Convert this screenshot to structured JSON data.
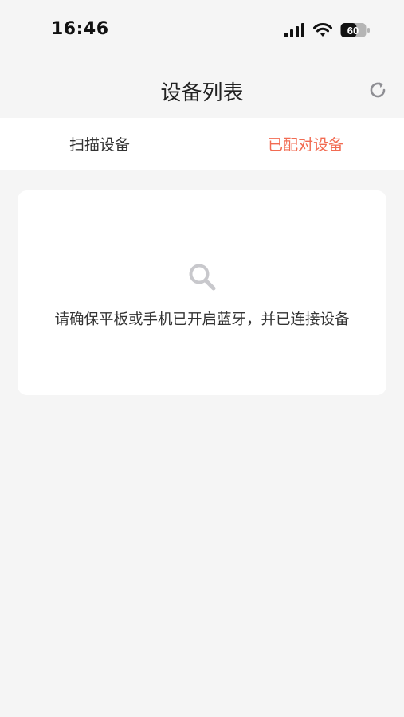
{
  "status_bar": {
    "time": "16:46",
    "battery": "60"
  },
  "header": {
    "title": "设备列表",
    "refresh_icon": "refresh-icon"
  },
  "tabs": [
    {
      "label": "扫描设备",
      "active": false
    },
    {
      "label": "已配对设备",
      "active": true
    }
  ],
  "empty_state": {
    "icon": "search-icon",
    "message": "请确保平板或手机已开启蓝牙，并已连接设备"
  },
  "colors": {
    "accent": "#f26b52",
    "background": "#f5f5f5",
    "card": "#ffffff",
    "icon_gray": "#c8c8cc"
  }
}
